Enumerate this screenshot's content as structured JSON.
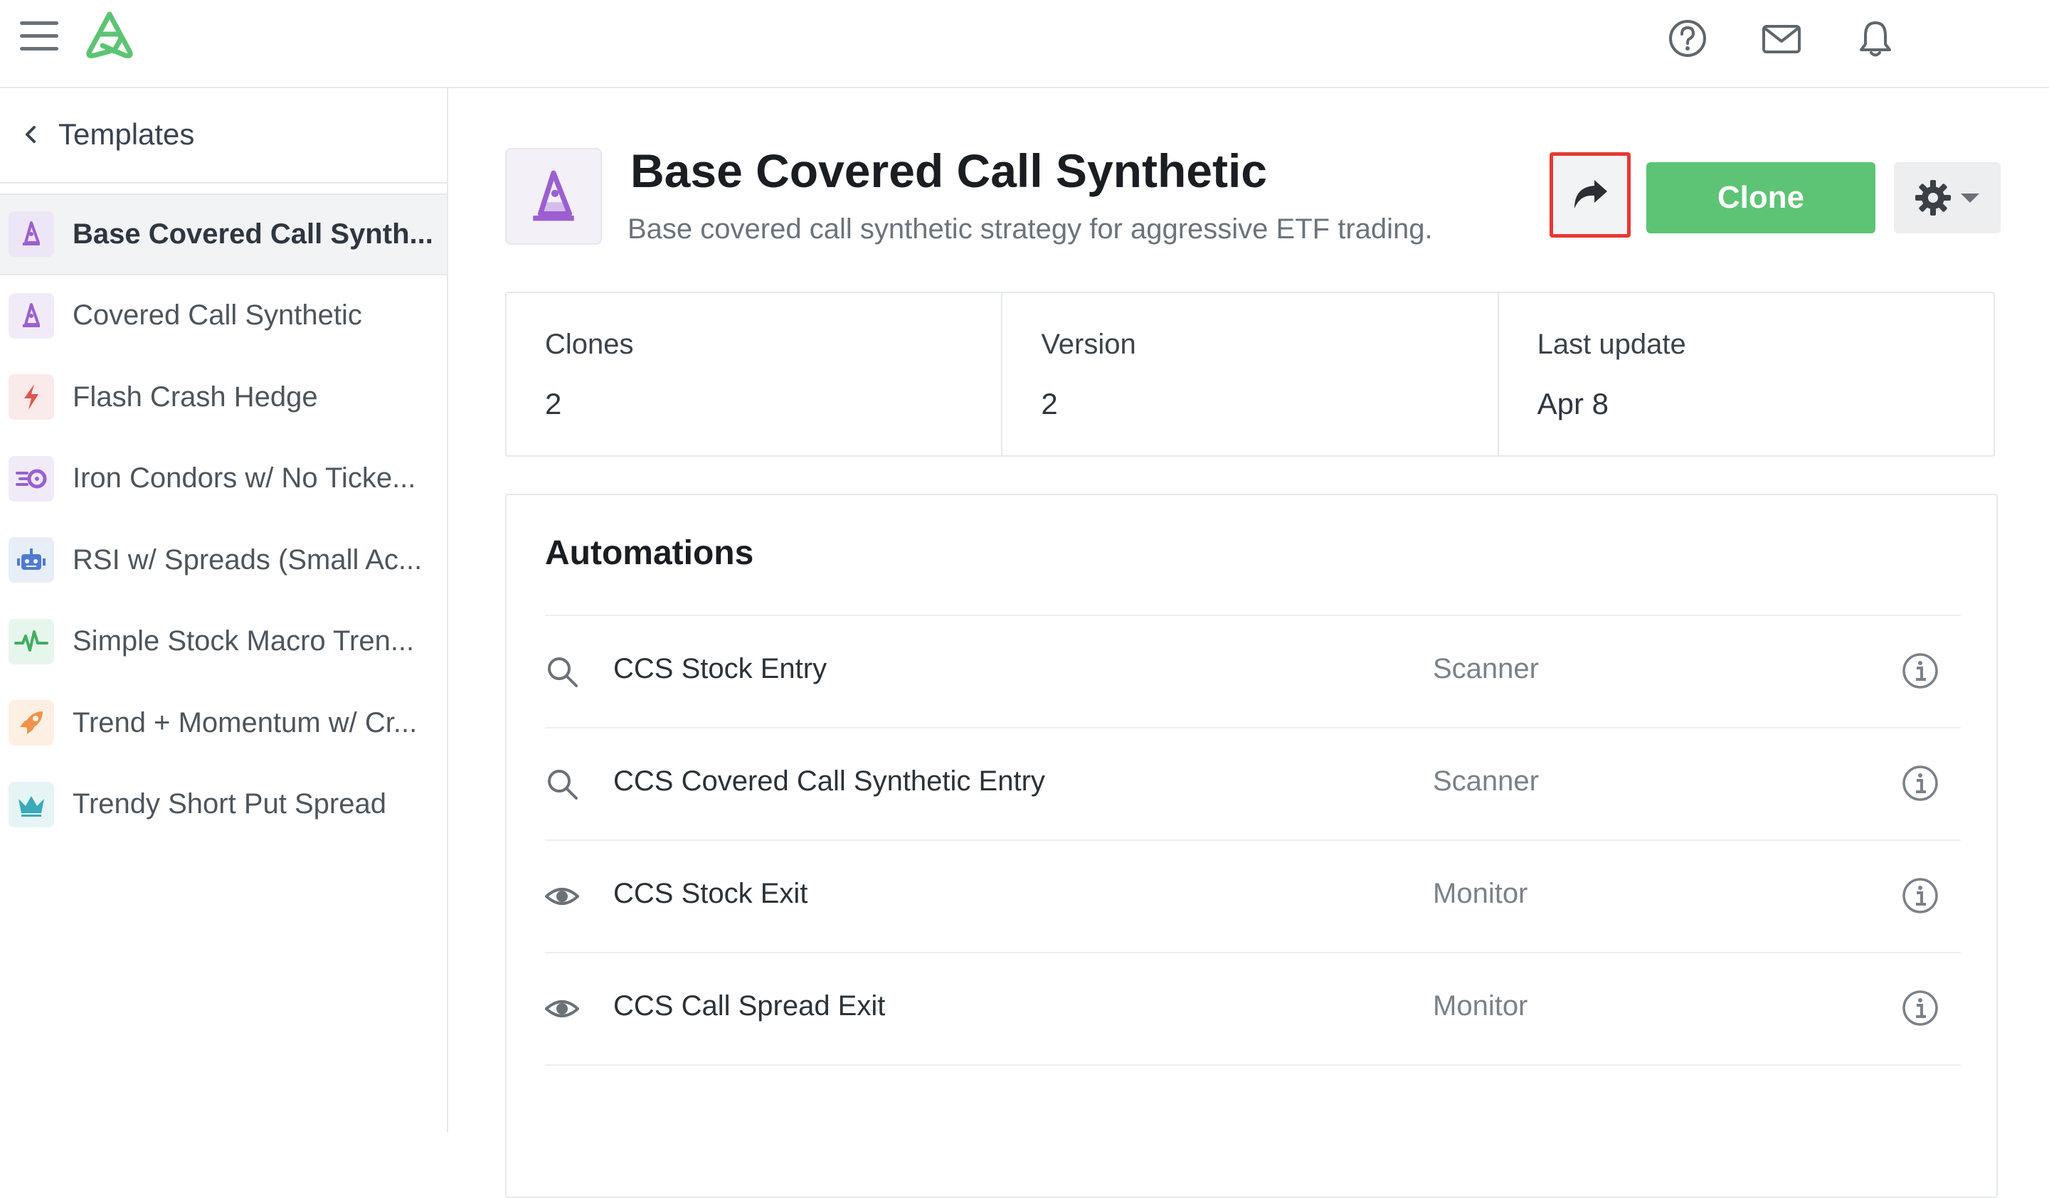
{
  "header": {
    "icons": [
      "menu-icon",
      "logo-icon",
      "help-icon",
      "mail-icon",
      "bell-icon"
    ]
  },
  "sidebar": {
    "back_label": "Templates",
    "items": [
      {
        "label": "Base Covered Call Synth...",
        "icon": "wizard-hat-icon",
        "active": true
      },
      {
        "label": "Covered Call Synthetic",
        "icon": "wizard-hat-icon",
        "active": false
      },
      {
        "label": "Flash Crash Hedge",
        "icon": "lightning-icon",
        "active": false
      },
      {
        "label": "Iron Condors w/ No Ticke...",
        "icon": "hurricane-icon",
        "active": false
      },
      {
        "label": "RSI w/ Spreads (Small Ac...",
        "icon": "robot-icon",
        "active": false
      },
      {
        "label": "Simple Stock Macro Tren...",
        "icon": "heartbeat-icon",
        "active": false
      },
      {
        "label": "Trend + Momentum w/ Cr...",
        "icon": "rocket-icon",
        "active": false
      },
      {
        "label": "Trendy Short Put Spread",
        "icon": "crown-icon",
        "active": false
      }
    ]
  },
  "template": {
    "title": "Base Covered Call Synthetic",
    "description": "Base covered call synthetic strategy for aggressive ETF trading.",
    "clone_label": "Clone"
  },
  "stats": [
    {
      "label": "Clones",
      "value": "2"
    },
    {
      "label": "Version",
      "value": "2"
    },
    {
      "label": "Last update",
      "value": "Apr 8"
    }
  ],
  "automations": {
    "title": "Automations",
    "rows": [
      {
        "name": "CCS Stock Entry",
        "type": "Scanner",
        "icon": "search-icon"
      },
      {
        "name": "CCS Covered Call Synthetic Entry",
        "type": "Scanner",
        "icon": "search-icon"
      },
      {
        "name": "CCS Stock Exit",
        "type": "Monitor",
        "icon": "eye-icon"
      },
      {
        "name": "CCS Call Spread Exit",
        "type": "Monitor",
        "icon": "eye-icon"
      }
    ]
  },
  "colors": {
    "accent_green": "#5cc474",
    "highlight_red": "#e53935",
    "wizard_purple": "#9b5fd1"
  }
}
